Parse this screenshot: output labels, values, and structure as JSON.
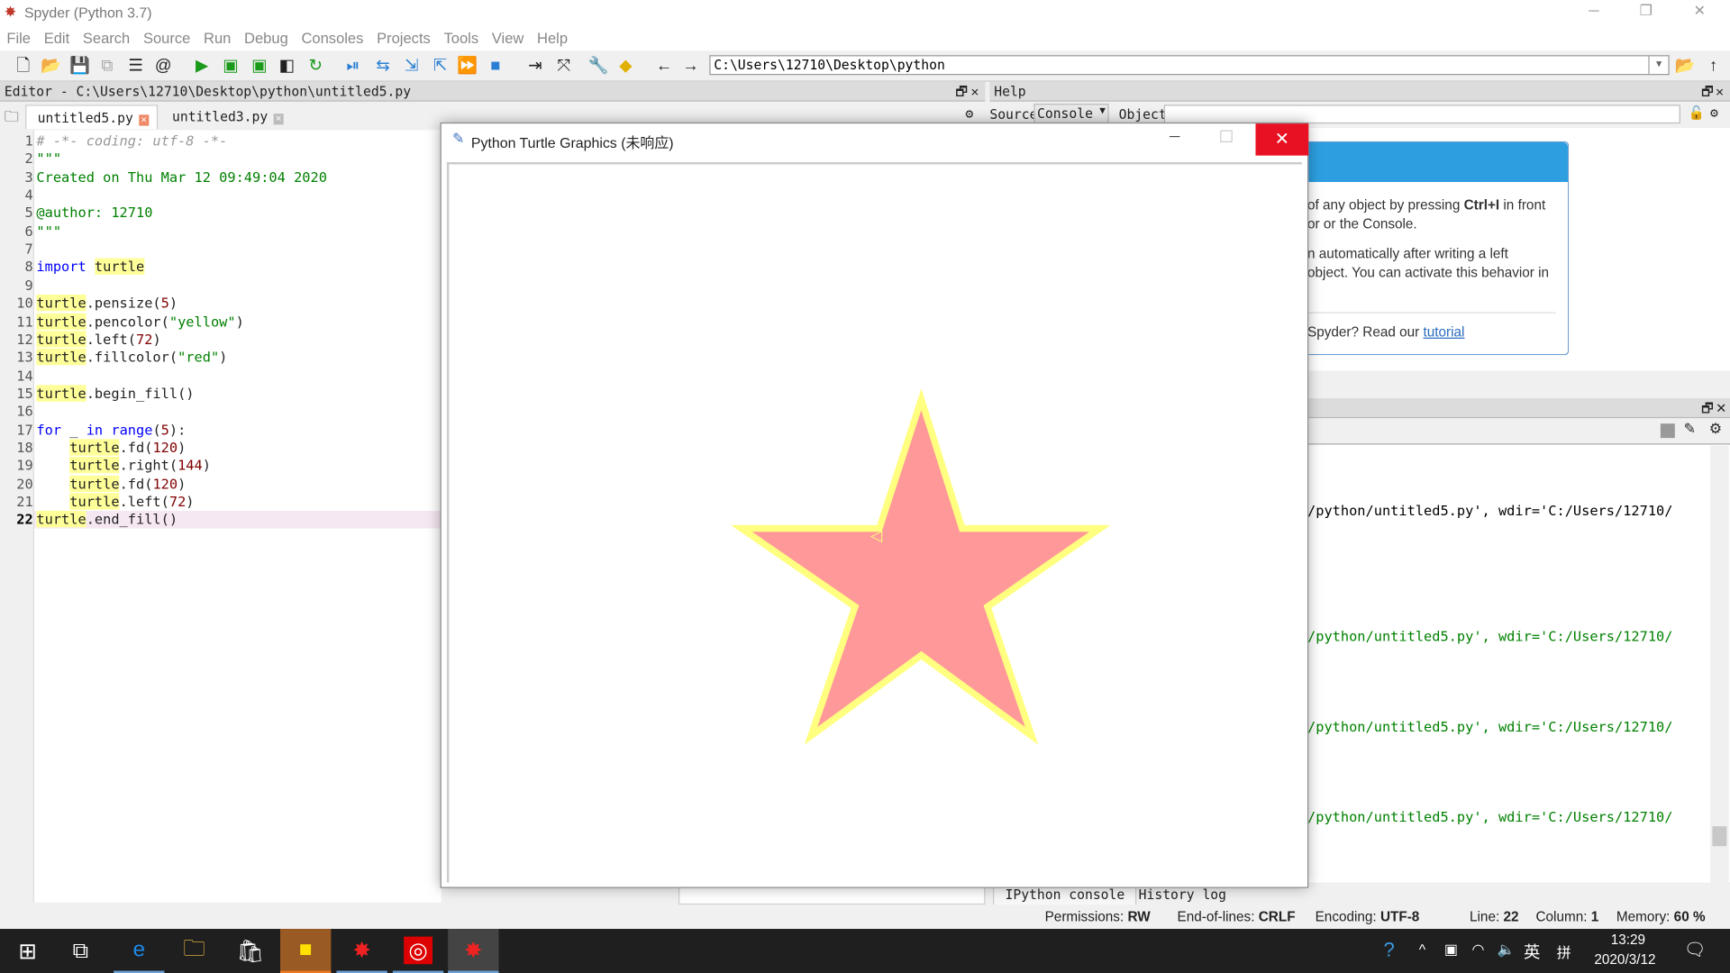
{
  "window": {
    "title": "Spyder (Python 3.7)",
    "min": "─",
    "max": "❐",
    "close": "✕"
  },
  "menu": [
    "File",
    "Edit",
    "Search",
    "Source",
    "Run",
    "Debug",
    "Consoles",
    "Projects",
    "Tools",
    "View",
    "Help"
  ],
  "toolbar": {
    "path": "C:\\Users\\12710\\Desktop\\python"
  },
  "editor": {
    "header": "Editor - C:\\Users\\12710\\Desktop\\python\\untitled5.py",
    "tabs": [
      {
        "label": "untitled5.py",
        "active": true
      },
      {
        "label": "untitled3.py",
        "active": false
      }
    ],
    "current_line": 22,
    "lines": [
      [
        [
          "# -*- coding: utf-8 -*-",
          "cm"
        ]
      ],
      [
        [
          "\"\"\"",
          "st"
        ]
      ],
      [
        [
          "Created on Thu Mar 12 09:49:04 2020",
          "st"
        ]
      ],
      [],
      [
        [
          "@author: 12710",
          "st"
        ]
      ],
      [
        [
          "\"\"\"",
          "st"
        ]
      ],
      [],
      [
        [
          "import",
          "kw"
        ],
        [
          " ",
          ""
        ],
        [
          "turtle",
          "hl"
        ]
      ],
      [],
      [
        [
          "turtle",
          "hl"
        ],
        [
          ".pensize(",
          ""
        ],
        [
          "5",
          "nm"
        ],
        [
          ")",
          ""
        ]
      ],
      [
        [
          "turtle",
          "hl"
        ],
        [
          ".pencolor(",
          ""
        ],
        [
          "\"yellow\"",
          "st"
        ],
        [
          ")",
          ""
        ]
      ],
      [
        [
          "turtle",
          "hl"
        ],
        [
          ".left(",
          ""
        ],
        [
          "72",
          "nm"
        ],
        [
          ")",
          ""
        ]
      ],
      [
        [
          "turtle",
          "hl"
        ],
        [
          ".fillcolor(",
          ""
        ],
        [
          "\"red\"",
          "st"
        ],
        [
          ")",
          ""
        ]
      ],
      [],
      [
        [
          "turtle",
          "hl"
        ],
        [
          ".begin_fill()",
          ""
        ]
      ],
      [],
      [
        [
          "for",
          "kw"
        ],
        [
          " _ ",
          ""
        ],
        [
          "in",
          "kw"
        ],
        [
          " ",
          ""
        ],
        [
          "range",
          "bi"
        ],
        [
          "(",
          ""
        ],
        [
          "5",
          "nm"
        ],
        [
          "):",
          ""
        ]
      ],
      [
        [
          "    ",
          ""
        ],
        [
          "turtle",
          "hl"
        ],
        [
          ".fd(",
          ""
        ],
        [
          "120",
          "nm"
        ],
        [
          ")",
          ""
        ]
      ],
      [
        [
          "    ",
          ""
        ],
        [
          "turtle",
          "hl"
        ],
        [
          ".right(",
          ""
        ],
        [
          "144",
          "nm"
        ],
        [
          ")",
          ""
        ]
      ],
      [
        [
          "    ",
          ""
        ],
        [
          "turtle",
          "hl"
        ],
        [
          ".fd(",
          ""
        ],
        [
          "120",
          "nm"
        ],
        [
          ")",
          ""
        ]
      ],
      [
        [
          "    ",
          ""
        ],
        [
          "turtle",
          "hl"
        ],
        [
          ".left(",
          ""
        ],
        [
          "72",
          "nm"
        ],
        [
          ")",
          ""
        ]
      ],
      [
        [
          "turtle",
          "hl"
        ],
        [
          ".end_fill()",
          ""
        ]
      ]
    ]
  },
  "help": {
    "header": "Help",
    "source_label": "Source",
    "source_value": "Console",
    "object_label": "Object",
    "text1a": "of any object by pressing ",
    "text1b": "Ctrl+I",
    "text1c": " in front",
    "text2": "or or the Console.",
    "text3": "n automatically after writing a left",
    "text4": "object. You can activate this behavior in",
    "text5": "Spyder? Read our ",
    "link": "tutorial"
  },
  "turtle_window": {
    "title": "Python Turtle Graphics (未响应)",
    "fill": "#ff9999",
    "pen": "#ffff80"
  },
  "console": {
    "lines": [
      {
        "text": "/python/untitled5.py', wdir='C:/Users/12710/",
        "color": "#000000"
      },
      {
        "text": "/python/untitled5.py', wdir='C:/Users/12710/",
        "color": "#008000"
      },
      {
        "text": "/python/untitled5.py', wdir='C:/Users/12710/",
        "color": "#008000"
      },
      {
        "text": "/python/untitled5.py', wdir='C:/Users/12710/",
        "color": "#008000"
      }
    ],
    "tabs": [
      "IPython console",
      "History log"
    ]
  },
  "status": {
    "perm_label": "Permissions:",
    "perm": "RW",
    "eol_label": "End-of-lines:",
    "eol": "CRLF",
    "enc_label": "Encoding:",
    "enc": "UTF-8",
    "line_label": "Line:",
    "line": "22",
    "col_label": "Column:",
    "col": "1",
    "mem_label": "Memory:",
    "mem": "60 %"
  },
  "taskbar": {
    "time": "13:29",
    "date": "2020/3/12",
    "ime": "英",
    "ime2": "拼"
  }
}
